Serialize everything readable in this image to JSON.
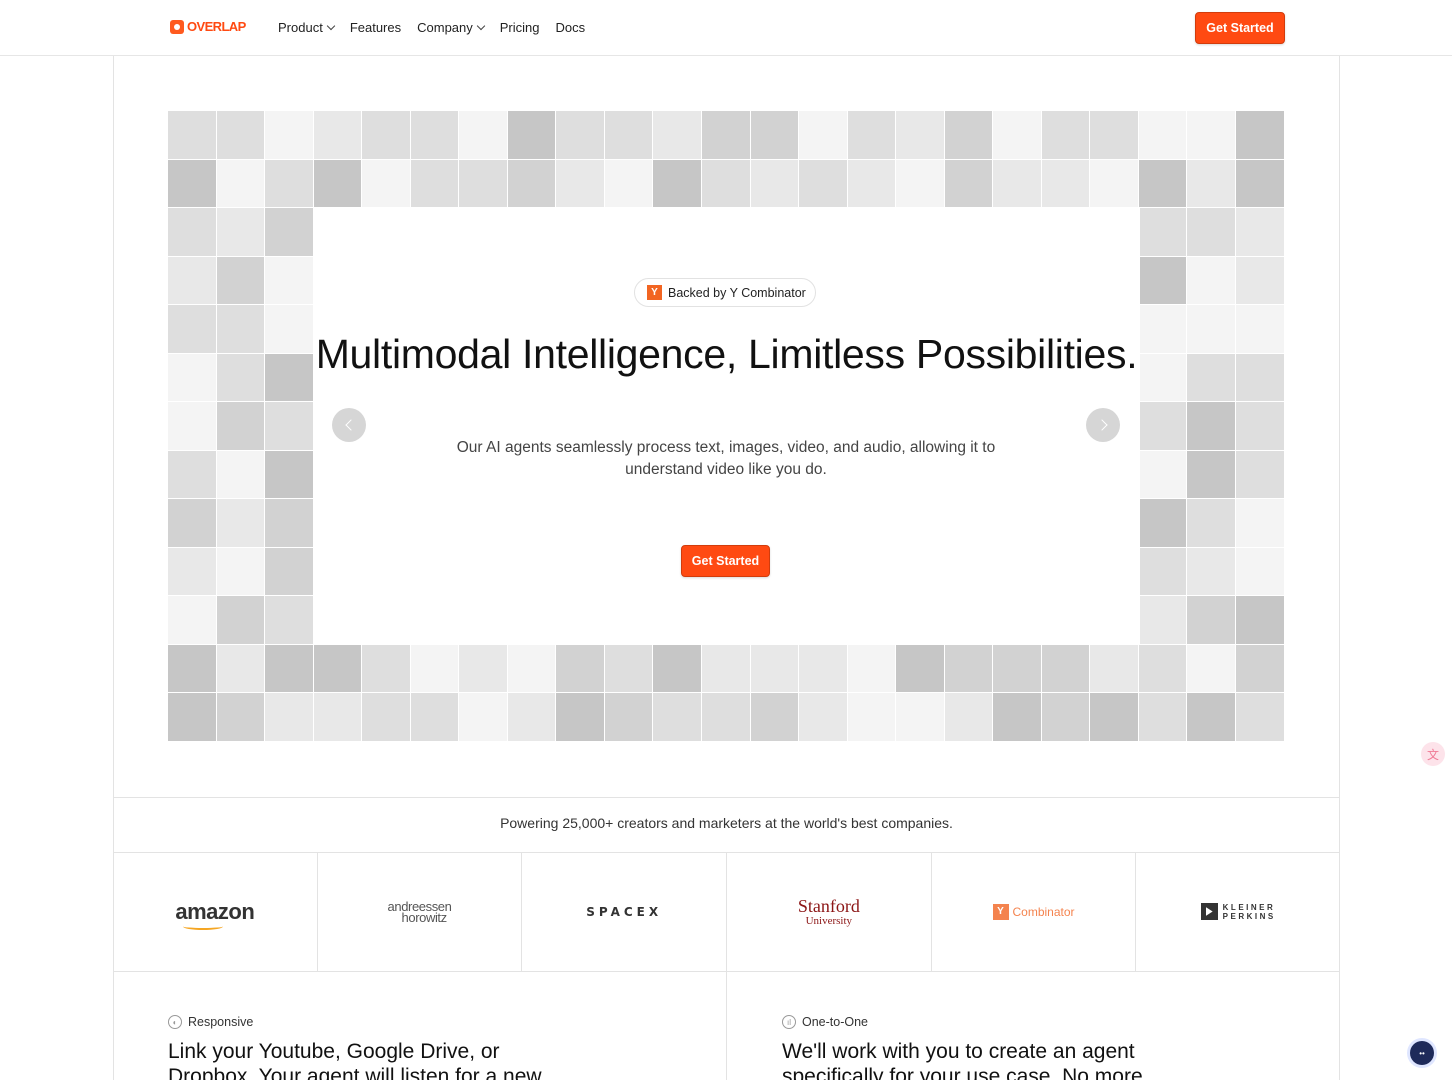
{
  "nav": {
    "logo_text": "OVERLAP",
    "links": [
      {
        "label": "Product",
        "has_dropdown": true
      },
      {
        "label": "Features",
        "has_dropdown": false
      },
      {
        "label": "Company",
        "has_dropdown": true
      },
      {
        "label": "Pricing",
        "has_dropdown": false
      },
      {
        "label": "Docs",
        "has_dropdown": false
      }
    ],
    "cta_label": "Get Started"
  },
  "hero": {
    "badge_icon": "Y",
    "badge_label": "Backed by Y Combinator",
    "title": "Multimodal Intelligence, Limitless Possibilities.",
    "subtitle": "Our AI agents seamlessly process text, images, video, and audio, allowing it to understand video like you do.",
    "cta_label": "Get Started",
    "prev_icon": "chevron-left-icon",
    "next_icon": "chevron-right-icon"
  },
  "social_proof": {
    "text": "Powering 25,000+ creators and marketers at the world's best companies.",
    "logos": [
      {
        "name": "amazon",
        "text": "amazon"
      },
      {
        "name": "andreessen-horowitz",
        "line1": "andreessen",
        "line2": "horowitz"
      },
      {
        "name": "spacex",
        "text": "SPACEX"
      },
      {
        "name": "stanford",
        "line1": "Stanford",
        "line2": "University"
      },
      {
        "name": "y-combinator",
        "mark": "Y",
        "text": "Combinator"
      },
      {
        "name": "kleiner-perkins",
        "line1": "KLEINER",
        "line2": "PERKINS"
      }
    ]
  },
  "features": [
    {
      "tag": "Responsive",
      "icon": "palette-icon",
      "text": "Link your Youtube, Google Drive, or Dropbox. Your agent will listen for a new"
    },
    {
      "tag": "One-to-One",
      "icon": "chart-icon",
      "text": "We'll work with you to create an agent specifically for your use case. No more"
    }
  ],
  "colors": {
    "accent": "#ff4a12",
    "tile_shades": [
      "#f4f4f4",
      "#e8e8e8",
      "#dedede",
      "#d2d2d2",
      "#c6c6c6"
    ]
  }
}
